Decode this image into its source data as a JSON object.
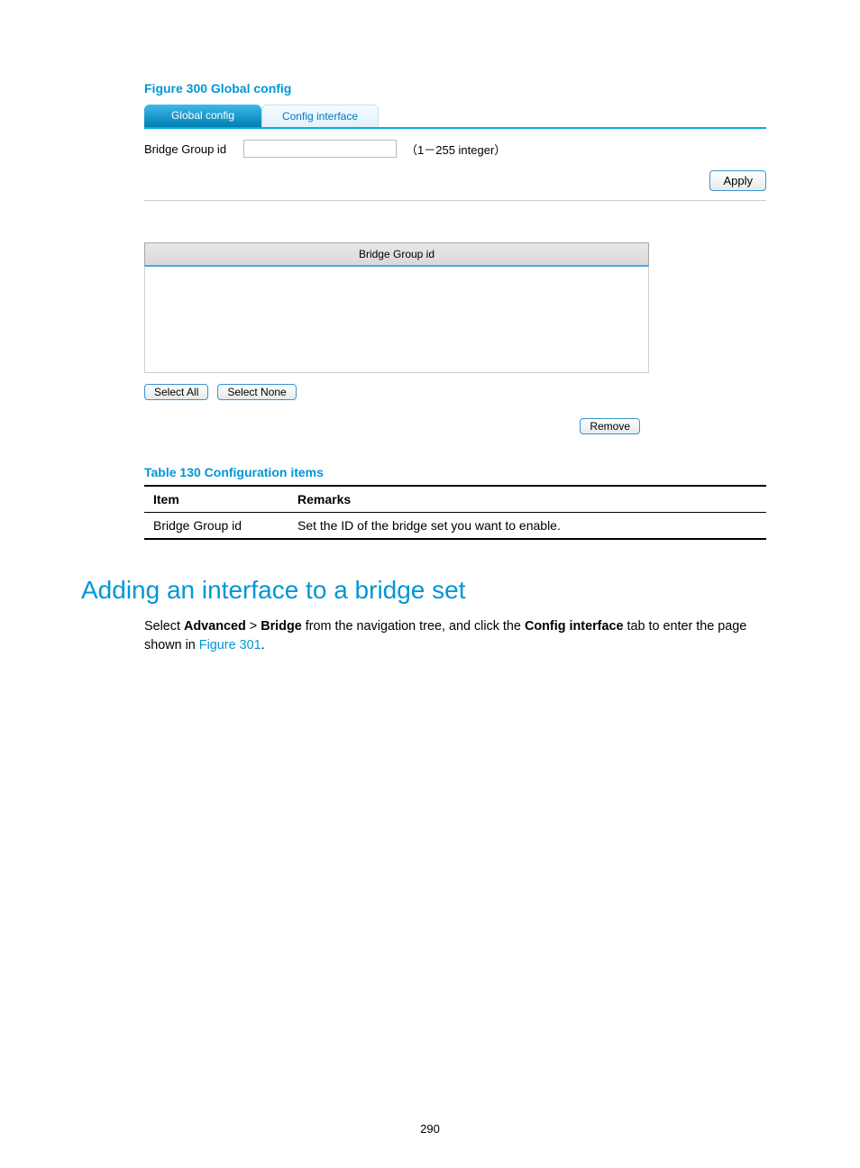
{
  "figure": {
    "caption": "Figure 300 Global config"
  },
  "tabs": {
    "active": "Global config",
    "inactive": "Config interface"
  },
  "form": {
    "label": "Bridge Group id",
    "input_value": "",
    "hint": "（1－255 integer）",
    "apply": "Apply"
  },
  "list": {
    "header": "Bridge Group id",
    "select_all": "Select All",
    "select_none": "Select None",
    "remove": "Remove"
  },
  "table": {
    "caption": "Table 130 Configuration items",
    "headers": {
      "item": "Item",
      "remarks": "Remarks"
    },
    "row": {
      "item": "Bridge Group id",
      "remarks": "Set the ID of the bridge set you want to enable."
    }
  },
  "section": {
    "title": "Adding an interface to a bridge set"
  },
  "para": {
    "p1a": "Select ",
    "p1_advanced": "Advanced",
    "p1_sep": " > ",
    "p1_bridge": "Bridge",
    "p1b": " from the navigation tree, and click the ",
    "p1_tab": "Config interface",
    "p1c": " tab to enter the page shown in ",
    "p1_link": "Figure 301",
    "p1d": "."
  },
  "page": {
    "number": "290"
  }
}
